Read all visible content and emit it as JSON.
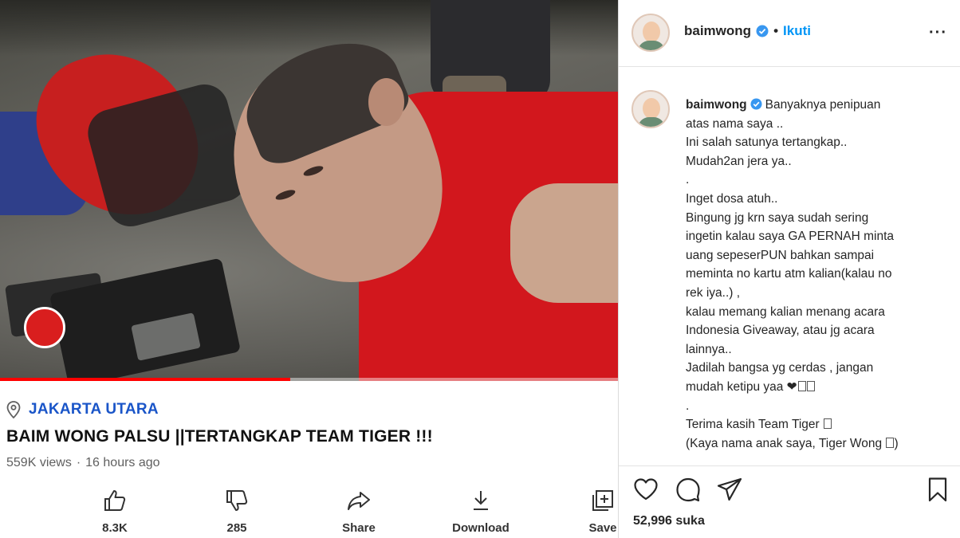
{
  "youtube": {
    "location": "JAKARTA UTARA",
    "title": "BAIM WONG PALSU ||TERTANGKAP TEAM TIGER !!!",
    "views": "559K views",
    "separator": "·",
    "time_ago": "16 hours ago",
    "progress_fraction": 0.47,
    "actions": [
      {
        "name": "like",
        "label": "8.3K",
        "icon": "thumbs-up-icon"
      },
      {
        "name": "dislike",
        "label": "285",
        "icon": "thumbs-down-icon"
      },
      {
        "name": "share",
        "label": "Share",
        "icon": "share-arrow-icon"
      },
      {
        "name": "download",
        "label": "Download",
        "icon": "download-icon"
      },
      {
        "name": "save",
        "label": "Save",
        "icon": "add-to-playlist-icon"
      }
    ]
  },
  "instagram": {
    "header": {
      "username": "baimwong",
      "dot": "•",
      "follow": "Ikuti",
      "more": "···"
    },
    "caption": {
      "username": "baimwong",
      "lines": [
        "Banyaknya penipuan",
        "atas nama saya ..",
        "Ini salah satunya tertangkap..",
        "Mudah2an jera ya..",
        ".",
        "Inget dosa atuh..",
        "Bingung jg krn saya sudah sering",
        "ingetin kalau saya GA PERNAH minta",
        "uang sepeserPUN bahkan sampai",
        "meminta no kartu atm kalian(kalau no",
        "rek iya..) ,",
        "kalau memang kalian menang acara",
        "Indonesia Giveaway, atau jg acara",
        "lainnya..",
        "Jadilah bangsa yg cerdas , jangan",
        "mudah ketipu yaa ❤",
        ".",
        "Terima kasih Team Tiger",
        "(Kaya nama anak saya, Tiger Wong"
      ],
      "line_suffix_last": ")"
    },
    "likes": "52,996 suka",
    "colors": {
      "link": "#0095f6",
      "verified": "#3897f0"
    }
  },
  "colors": {
    "youtube_location": "#1a55c8",
    "progress": "#ff0000"
  }
}
